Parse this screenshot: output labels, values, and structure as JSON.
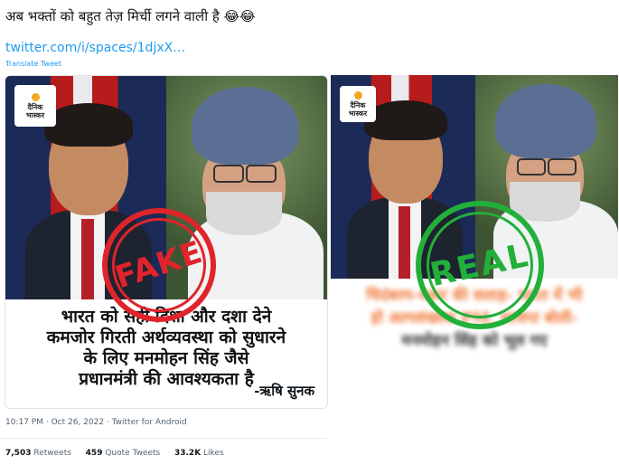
{
  "tweet": {
    "text": "अब भक्तों को बहुत तेज़ मिर्ची लगने वाली है 😂😂",
    "link": "twitter.com/i/spaces/1djxX…",
    "translate": "Translate Tweet",
    "meta": "10:17 PM · Oct 26, 2022 · Twitter for Android",
    "retweets_count": "7,503",
    "retweets_label": "Retweets",
    "quotes_count": "459",
    "quotes_label": "Quote Tweets",
    "likes_count": "33.2K",
    "likes_label": "Likes"
  },
  "left_image": {
    "logo_line1": "दैनिक",
    "logo_line2": "भास्कर",
    "stamp": "FAKE",
    "caption_lines": [
      "भारत को सही दिशा और दशा देने",
      "कमजोर गिरती अर्थव्यवस्था को सुधारने",
      "के लिए मनमोहन सिंह जैसे",
      "प्रधानमंत्री की आवश्यकता है"
    ],
    "signature": "-ऋषि सुनक"
  },
  "right_image": {
    "logo_line1": "दैनिक",
    "logo_line2": "भास्कर",
    "stamp": "REAL",
    "blurred_lines": [
      "चिदंबरम-थरूर की सलाह- भारत में भी",
      "हो अल्पसंख्यक PM, भाजपा बोली-",
      "मनमोहन सिंह को भूल गए"
    ]
  },
  "colors": {
    "link": "#1d9bf0",
    "fake_red": "#e0242b",
    "real_green": "#22b03a",
    "blurred_text": "#f07a3a"
  }
}
